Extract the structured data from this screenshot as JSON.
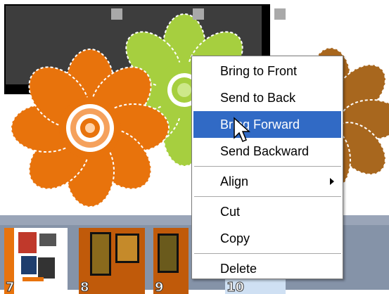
{
  "context_menu": {
    "items": [
      {
        "label": "Bring to Front"
      },
      {
        "label": "Send to Back"
      },
      {
        "label": "Bring Forward",
        "highlighted": true
      },
      {
        "label": "Send Backward"
      },
      {
        "label": "Align",
        "submenu": true
      },
      {
        "label": "Cut"
      },
      {
        "label": "Copy"
      },
      {
        "label": "Delete"
      }
    ]
  },
  "filmstrip": {
    "pages": [
      {
        "number": "7"
      },
      {
        "number": "8"
      },
      {
        "number": "9"
      },
      {
        "number": "10"
      }
    ]
  },
  "colors": {
    "orange_flower": "#e8730c",
    "green_flower": "#a6cf3f",
    "brown_flower": "#a8671e",
    "highlight": "#316ac5",
    "dark_block": "#3d3d3d"
  },
  "icons": [
    "arrow-cursor-icon",
    "submenu-arrow-icon"
  ]
}
